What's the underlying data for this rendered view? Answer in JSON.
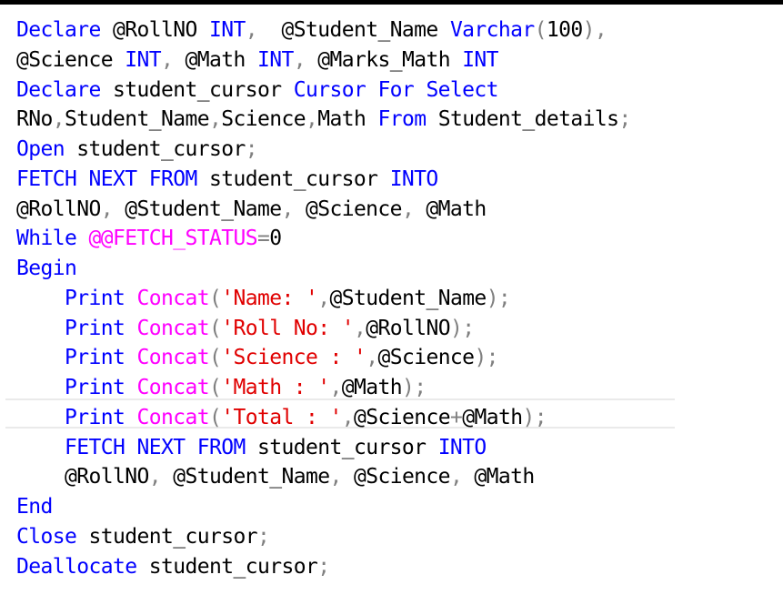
{
  "editor": {
    "lines": [
      {
        "tokens": [
          {
            "t": "Declare",
            "k": "kw"
          },
          {
            "t": " @RollNO ",
            "k": "id"
          },
          {
            "t": "INT",
            "k": "kw"
          },
          {
            "t": ",",
            "k": "op"
          },
          {
            "t": "  @Student_Name ",
            "k": "id"
          },
          {
            "t": "Varchar",
            "k": "kw"
          },
          {
            "t": "(",
            "k": "op"
          },
          {
            "t": "100",
            "k": "num"
          },
          {
            "t": "),",
            "k": "op"
          }
        ]
      },
      {
        "tokens": [
          {
            "t": "@Science ",
            "k": "id"
          },
          {
            "t": "INT",
            "k": "kw"
          },
          {
            "t": ",",
            "k": "op"
          },
          {
            "t": " @Math ",
            "k": "id"
          },
          {
            "t": "INT",
            "k": "kw"
          },
          {
            "t": ",",
            "k": "op"
          },
          {
            "t": " @Marks_Math ",
            "k": "id"
          },
          {
            "t": "INT",
            "k": "kw"
          }
        ]
      },
      {
        "tokens": [
          {
            "t": "Declare",
            "k": "kw"
          },
          {
            "t": " student_cursor ",
            "k": "id"
          },
          {
            "t": "Cursor",
            "k": "kw"
          },
          {
            "t": " ",
            "k": "id"
          },
          {
            "t": "For",
            "k": "kw"
          },
          {
            "t": " ",
            "k": "id"
          },
          {
            "t": "Select",
            "k": "kw"
          }
        ]
      },
      {
        "tokens": [
          {
            "t": "RNo",
            "k": "id"
          },
          {
            "t": ",",
            "k": "op"
          },
          {
            "t": "Student_Name",
            "k": "id"
          },
          {
            "t": ",",
            "k": "op"
          },
          {
            "t": "Science",
            "k": "id"
          },
          {
            "t": ",",
            "k": "op"
          },
          {
            "t": "Math ",
            "k": "id"
          },
          {
            "t": "From",
            "k": "kw"
          },
          {
            "t": " Student_details",
            "k": "id"
          },
          {
            "t": ";",
            "k": "op"
          }
        ]
      },
      {
        "tokens": [
          {
            "t": "Open",
            "k": "kw"
          },
          {
            "t": " student_cursor",
            "k": "id"
          },
          {
            "t": ";",
            "k": "op"
          }
        ]
      },
      {
        "tokens": [
          {
            "t": "FETCH NEXT FROM",
            "k": "kw"
          },
          {
            "t": " student_cursor ",
            "k": "id"
          },
          {
            "t": "INTO",
            "k": "kw"
          }
        ]
      },
      {
        "tokens": [
          {
            "t": "@RollNO",
            "k": "id"
          },
          {
            "t": ",",
            "k": "op"
          },
          {
            "t": " @Student_Name",
            "k": "id"
          },
          {
            "t": ",",
            "k": "op"
          },
          {
            "t": " @Science",
            "k": "id"
          },
          {
            "t": ",",
            "k": "op"
          },
          {
            "t": " @Math",
            "k": "id"
          }
        ]
      },
      {
        "tokens": [
          {
            "t": "While",
            "k": "kw"
          },
          {
            "t": " ",
            "k": "id"
          },
          {
            "t": "@@FETCH_STATUS",
            "k": "fn"
          },
          {
            "t": "=",
            "k": "op"
          },
          {
            "t": "0",
            "k": "num"
          }
        ]
      },
      {
        "tokens": [
          {
            "t": "Begin",
            "k": "kw"
          }
        ]
      },
      {
        "tokens": [
          {
            "t": "    ",
            "k": "id"
          },
          {
            "t": "Print",
            "k": "kw"
          },
          {
            "t": " ",
            "k": "id"
          },
          {
            "t": "Concat",
            "k": "fn"
          },
          {
            "t": "(",
            "k": "op"
          },
          {
            "t": "'Name: '",
            "k": "str"
          },
          {
            "t": ",",
            "k": "op"
          },
          {
            "t": "@Student_Name",
            "k": "id"
          },
          {
            "t": ");",
            "k": "op"
          }
        ]
      },
      {
        "tokens": [
          {
            "t": "    ",
            "k": "id"
          },
          {
            "t": "Print",
            "k": "kw"
          },
          {
            "t": " ",
            "k": "id"
          },
          {
            "t": "Concat",
            "k": "fn"
          },
          {
            "t": "(",
            "k": "op"
          },
          {
            "t": "'Roll No: '",
            "k": "str"
          },
          {
            "t": ",",
            "k": "op"
          },
          {
            "t": "@RollNO",
            "k": "id"
          },
          {
            "t": ");",
            "k": "op"
          }
        ]
      },
      {
        "tokens": [
          {
            "t": "    ",
            "k": "id"
          },
          {
            "t": "Print",
            "k": "kw"
          },
          {
            "t": " ",
            "k": "id"
          },
          {
            "t": "Concat",
            "k": "fn"
          },
          {
            "t": "(",
            "k": "op"
          },
          {
            "t": "'Science : '",
            "k": "str"
          },
          {
            "t": ",",
            "k": "op"
          },
          {
            "t": "@Science",
            "k": "id"
          },
          {
            "t": ");",
            "k": "op"
          }
        ]
      },
      {
        "tokens": [
          {
            "t": "    ",
            "k": "id"
          },
          {
            "t": "Print",
            "k": "kw"
          },
          {
            "t": " ",
            "k": "id"
          },
          {
            "t": "Concat",
            "k": "fn"
          },
          {
            "t": "(",
            "k": "op"
          },
          {
            "t": "'Math : '",
            "k": "str"
          },
          {
            "t": ",",
            "k": "op"
          },
          {
            "t": "@Math",
            "k": "id"
          },
          {
            "t": ");",
            "k": "op"
          }
        ]
      },
      {
        "tokens": [
          {
            "t": "    ",
            "k": "id"
          },
          {
            "t": "Print",
            "k": "kw"
          },
          {
            "t": " ",
            "k": "id"
          },
          {
            "t": "Concat",
            "k": "fn"
          },
          {
            "t": "(",
            "k": "op"
          },
          {
            "t": "'Total : '",
            "k": "str"
          },
          {
            "t": ",",
            "k": "op"
          },
          {
            "t": "@Science",
            "k": "id"
          },
          {
            "t": "+",
            "k": "op"
          },
          {
            "t": "@Math",
            "k": "id"
          },
          {
            "t": ");",
            "k": "op"
          }
        ]
      },
      {
        "tokens": [
          {
            "t": "    ",
            "k": "id"
          },
          {
            "t": "FETCH NEXT FROM",
            "k": "kw"
          },
          {
            "t": " student_cursor ",
            "k": "id"
          },
          {
            "t": "INTO",
            "k": "kw"
          }
        ]
      },
      {
        "tokens": [
          {
            "t": "    @RollNO",
            "k": "id"
          },
          {
            "t": ",",
            "k": "op"
          },
          {
            "t": " @Student_Name",
            "k": "id"
          },
          {
            "t": ",",
            "k": "op"
          },
          {
            "t": " @Science",
            "k": "id"
          },
          {
            "t": ",",
            "k": "op"
          },
          {
            "t": " @Math",
            "k": "id"
          }
        ]
      },
      {
        "tokens": [
          {
            "t": "End",
            "k": "kw"
          }
        ]
      },
      {
        "tokens": [
          {
            "t": "Close",
            "k": "kw"
          },
          {
            "t": " student_cursor",
            "k": "id"
          },
          {
            "t": ";",
            "k": "op"
          }
        ]
      },
      {
        "tokens": [
          {
            "t": "Deallocate",
            "k": "kw"
          },
          {
            "t": " student_cursor",
            "k": "id"
          },
          {
            "t": ";",
            "k": "op"
          }
        ]
      }
    ]
  }
}
